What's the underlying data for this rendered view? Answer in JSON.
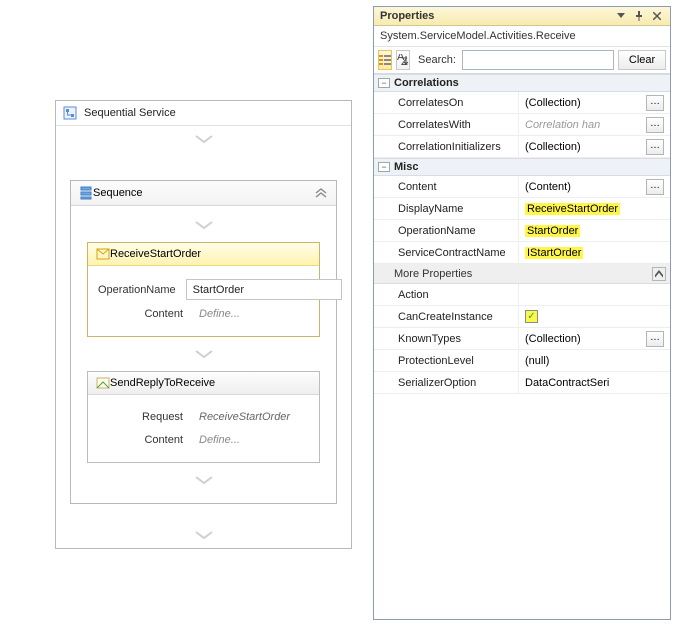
{
  "designer": {
    "outer_title": "Sequential Service",
    "sequence_title": "Sequence",
    "receive": {
      "title": "ReceiveStartOrder",
      "row1_label": "OperationName",
      "row1_value": "StartOrder",
      "row2_label": "Content",
      "row2_value": "Define..."
    },
    "reply": {
      "title": "SendReplyToReceive",
      "row1_label": "Request",
      "row1_value": "ReceiveStartOrder",
      "row2_label": "Content",
      "row2_value": "Define..."
    }
  },
  "props": {
    "title": "Properties",
    "subtitle": "System.ServiceModel.Activities.Receive",
    "search_label": "Search:",
    "search_value": "",
    "clear_label": "Clear",
    "cat1": "Correlations",
    "cat1_rows": [
      {
        "key": "CorrelatesOn",
        "val": "(Collection)",
        "ell": true
      },
      {
        "key": "CorrelatesWith",
        "val": "Correlation han",
        "placeholder": true,
        "ell": true
      },
      {
        "key": "CorrelationInitializers",
        "val": "(Collection)",
        "ell": true
      }
    ],
    "cat2": "Misc",
    "content_key": "Content",
    "content_val": "(Content)",
    "displayname_key": "DisplayName",
    "displayname_val": "ReceiveStartOrder",
    "opname_key": "OperationName",
    "opname_val": "StartOrder",
    "contract_key": "ServiceContractName",
    "contract_val": "IStartOrder",
    "more_label": "More Properties",
    "action_key": "Action",
    "action_val": "",
    "cancreate_key": "CanCreateInstance",
    "known_key": "KnownTypes",
    "known_val": "(Collection)",
    "prot_key": "ProtectionLevel",
    "prot_val": "(null)",
    "ser_key": "SerializerOption",
    "ser_val": "DataContractSeri"
  }
}
